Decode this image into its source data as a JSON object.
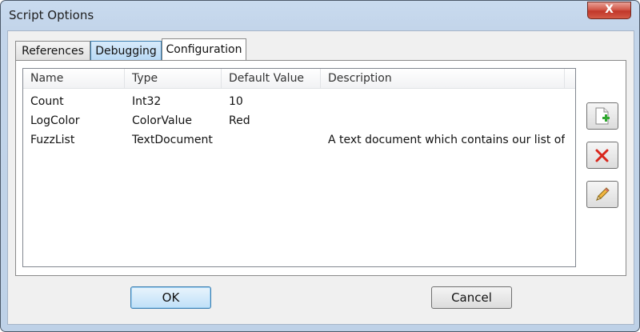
{
  "window": {
    "title": "Script Options",
    "close_glyph": "X"
  },
  "tabs": [
    {
      "label": "References"
    },
    {
      "label": "Debugging"
    },
    {
      "label": "Configuration"
    }
  ],
  "list": {
    "columns": [
      "Name",
      "Type",
      "Default Value",
      "Description"
    ],
    "rows": [
      {
        "name": "Count",
        "type": "Int32",
        "default": "10",
        "description": ""
      },
      {
        "name": "LogColor",
        "type": "ColorValue",
        "default": "Red",
        "description": ""
      },
      {
        "name": "FuzzList",
        "type": "TextDocument",
        "default": "",
        "description": "A text document which contains our list of..."
      }
    ]
  },
  "side_buttons": [
    {
      "icon": "add-document-icon"
    },
    {
      "icon": "delete-icon"
    },
    {
      "icon": "edit-pencil-icon"
    }
  ],
  "buttons": {
    "ok": "OK",
    "cancel": "Cancel"
  },
  "colors": {
    "selected_tab": "#b8d9f5",
    "close_button": "#c1372a",
    "delete_icon": "#d9261c",
    "add_icon": "#2fa82f"
  }
}
